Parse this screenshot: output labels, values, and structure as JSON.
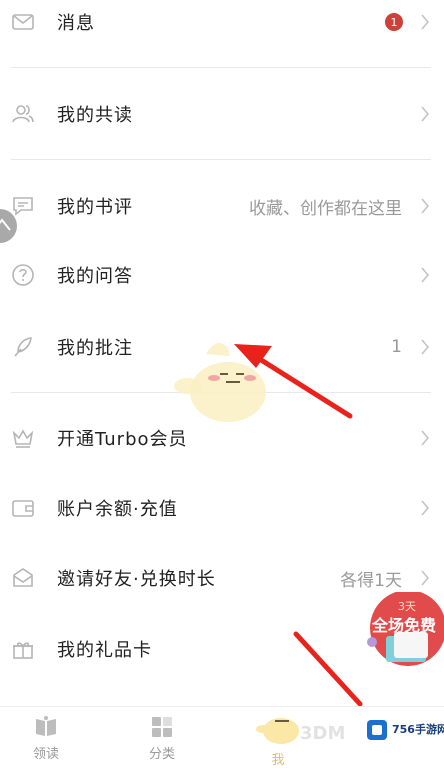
{
  "menu": [
    {
      "id": "messages",
      "label": "消息",
      "icon": "mail-icon",
      "badge": "1"
    },
    {
      "id": "shared-reading",
      "label": "我的共读",
      "icon": "people-icon"
    },
    {
      "id": "reviews",
      "label": "我的书评",
      "icon": "comment-icon",
      "hint": "收藏、创作都在这里"
    },
    {
      "id": "qa",
      "label": "我的问答",
      "icon": "question-icon"
    },
    {
      "id": "notes",
      "label": "我的批注",
      "icon": "feather-icon",
      "hint": "1"
    },
    {
      "id": "turbo",
      "label": "开通Turbo会员",
      "icon": "crown-icon"
    },
    {
      "id": "balance",
      "label": "账户余额·充值",
      "icon": "wallet-icon"
    },
    {
      "id": "invite",
      "label": "邀请好友·兑换时长",
      "icon": "envelope-icon",
      "hint": "各得1天"
    },
    {
      "id": "gift-card",
      "label": "我的礼品卡",
      "icon": "gift-icon"
    }
  ],
  "tabs": [
    {
      "label": "领读",
      "icon": "book-icon"
    },
    {
      "label": "分类",
      "icon": "grid-icon"
    },
    {
      "label": "我",
      "icon": "mascot-icon"
    }
  ],
  "promo": {
    "days": "3天",
    "text": "全场免费"
  },
  "watermark": {
    "brand": "756手游网",
    "sub": "3DM"
  },
  "colors": {
    "accent": "#c9433a",
    "arrow": "#e8231c",
    "chevron": "#c4c4c4",
    "icon": "#b5b5b5"
  }
}
